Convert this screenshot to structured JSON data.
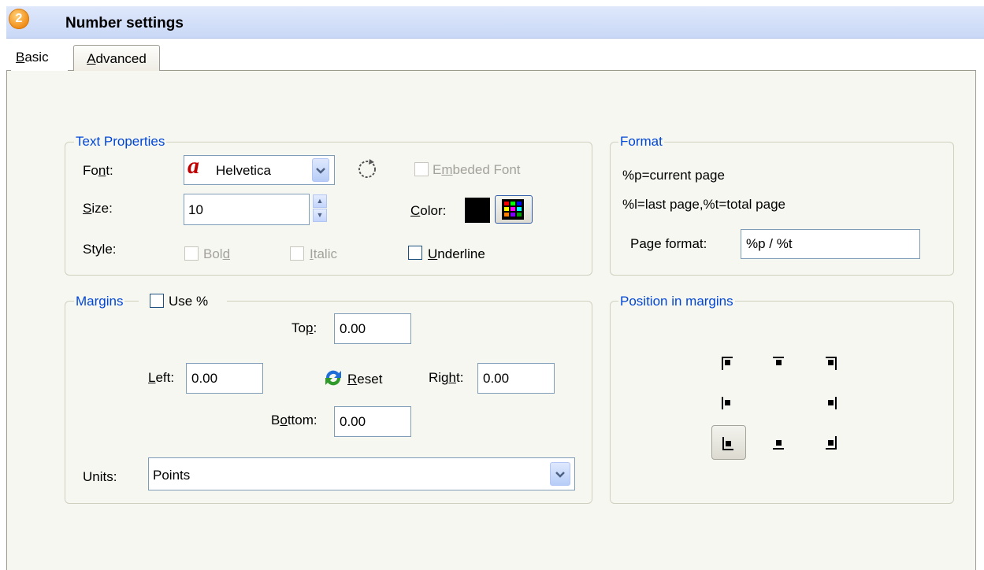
{
  "header": {
    "step_number": "2",
    "title": "Number settings"
  },
  "tabs": [
    {
      "label": "Basic",
      "selected": true
    },
    {
      "label": "Advanced",
      "selected": false
    }
  ],
  "text_properties": {
    "legend": "Text Properties",
    "font_label": "Font:",
    "font_value": "Helvetica",
    "font_icon": "font-a-icon",
    "refresh_icon": "refresh-icon",
    "embeded_font_label": "Embeded Font",
    "size_label": "Size:",
    "size_value": "10",
    "color_label": "Color:",
    "color_value": "#000000",
    "style_label": "Style:",
    "bold_label": "Bold",
    "italic_label": "Italic",
    "underline_label": "Underline"
  },
  "format": {
    "legend": "Format",
    "hint1": "%p=current page",
    "hint2": "%l=last page,%t=total page",
    "page_format_label": "Page format:",
    "page_format_value": "%p / %t"
  },
  "margins": {
    "legend": "Margins",
    "use_percent_label": "Use %",
    "top_label": "Top:",
    "top_value": "0.00",
    "left_label": "Left:",
    "left_value": "0.00",
    "right_label": "Right:",
    "right_value": "0.00",
    "bottom_label": "Bottom:",
    "bottom_value": "0.00",
    "reset_label": "Reset",
    "units_label": "Units:",
    "units_value": "Points"
  },
  "position": {
    "legend": "Position in margins",
    "selected": "bottom-left"
  },
  "colors": {
    "accent_blue": "#0046d5",
    "badge_orange": "#f08a14"
  }
}
